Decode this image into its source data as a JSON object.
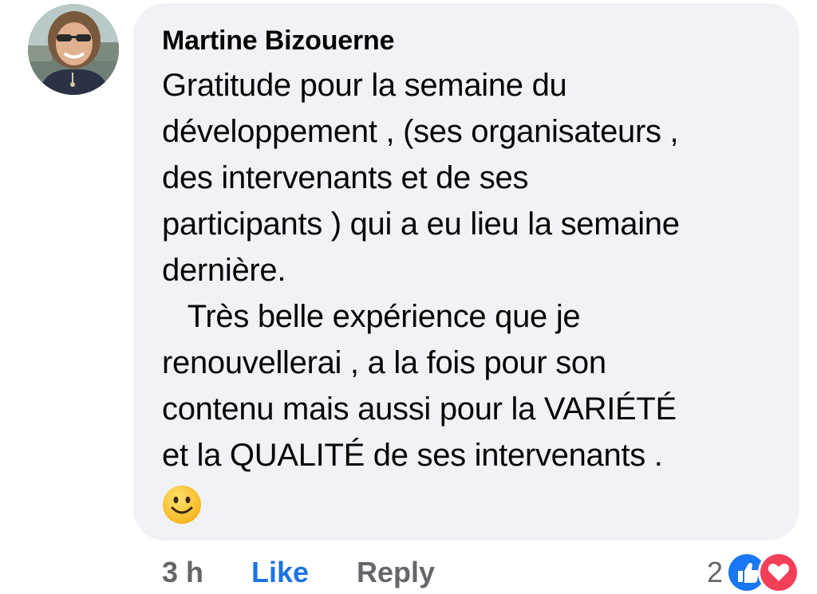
{
  "comment": {
    "author": "Martine Bizouerne",
    "lines": [
      "Gratitude pour la semaine du",
      "développement , (ses organisateurs ,",
      "des intervenants et de ses",
      "participants ) qui a eu lieu la semaine",
      "dernière.",
      "   Très belle expérience que je",
      "renouvellerai , a la fois pour son",
      "contenu mais aussi pour la VARIÉTÉ",
      "et la QUALITÉ de ses intervenants ."
    ],
    "emoji": "slightly-smiling-face"
  },
  "actions": {
    "time": "3 h",
    "like_label": "Like",
    "reply_label": "Reply",
    "reaction_count": "2"
  },
  "colors": {
    "bubble": "#f0f2f5",
    "like": "#1b74e4",
    "muted": "#65676b",
    "like_icon": "#1877f2",
    "love_icon": "#f33e58"
  },
  "icons": [
    "like-reaction-icon",
    "love-reaction-icon"
  ]
}
